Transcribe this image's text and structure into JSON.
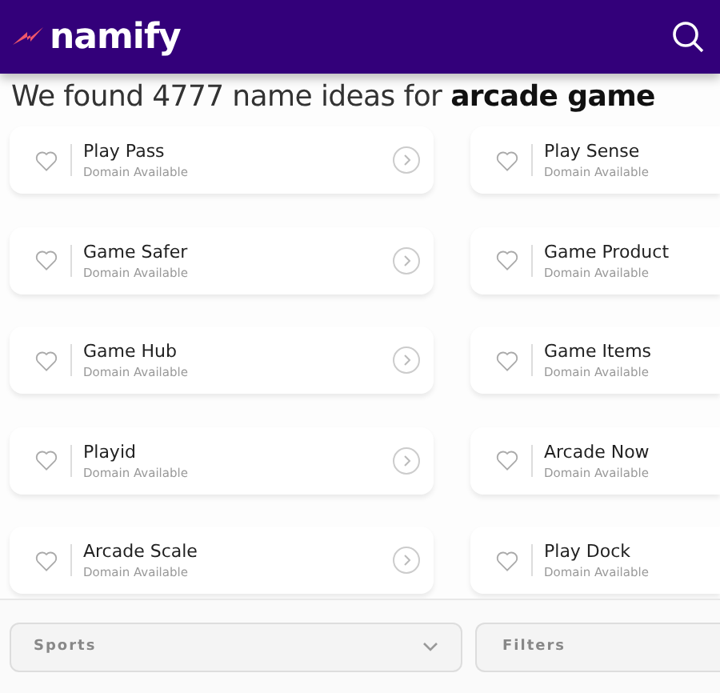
{
  "header": {
    "logo": "namify"
  },
  "headline": "We found 4777 name ideas for **arcade game**",
  "results": [
    {
      "name": "Play Pass",
      "status": "Domain Available",
      "favorite": false
    },
    {
      "name": "Play Sense",
      "status": "Domain Available",
      "favorite": false
    },
    {
      "name": "Game Safer",
      "status": "Domain Available",
      "favorite": false
    },
    {
      "name": "Game Product",
      "status": "Domain Available",
      "favorite": false
    },
    {
      "name": "Game Hub",
      "status": "Domain Available",
      "favorite": false
    },
    {
      "name": "Game Items",
      "status": "Domain Available",
      "favorite": false
    },
    {
      "name": "Playid",
      "status": "Domain Available",
      "favorite": false
    },
    {
      "name": "Arcade Now",
      "status": "Domain Available",
      "favorite": false
    },
    {
      "name": "Arcade Scale",
      "status": "Domain Available",
      "favorite": false
    },
    {
      "name": "Play Dock",
      "status": "Domain Available",
      "favorite": false
    }
  ],
  "bottom_bar": [
    {
      "kind": "dropdown",
      "label": "Sports"
    },
    {
      "kind": "button",
      "label": "Filters"
    }
  ]
}
